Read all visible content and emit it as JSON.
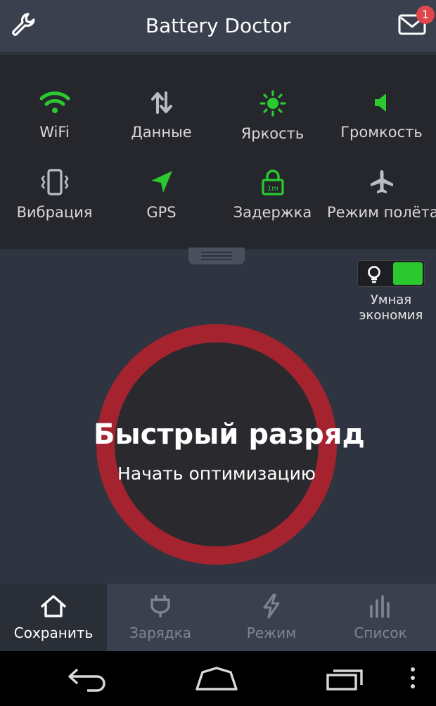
{
  "header": {
    "title": "Battery Doctor",
    "left_icon": "wrench-icon",
    "right_icon": "mail-icon",
    "notification_count": "1"
  },
  "toggles": [
    {
      "label": "WiFi",
      "icon": "wifi-icon",
      "state": "on"
    },
    {
      "label": "Данные",
      "icon": "data-transfer-icon",
      "state": "off"
    },
    {
      "label": "Яркость",
      "icon": "brightness-icon",
      "state": "on"
    },
    {
      "label": "Громкость",
      "icon": "volume-icon",
      "state": "on"
    },
    {
      "label": "Вибрация",
      "icon": "vibration-icon",
      "state": "off"
    },
    {
      "label": "GPS",
      "icon": "gps-icon",
      "state": "on"
    },
    {
      "label": "Задержка",
      "icon": "lock-timeout-icon",
      "state": "on",
      "icon_text": "1m"
    },
    {
      "label": "Режим полёта",
      "icon": "airplane-icon",
      "state": "off"
    }
  ],
  "smart_saving": {
    "label_line1": "Умная",
    "label_line2": "экономия",
    "enabled": true
  },
  "status_circle": {
    "title": "Быстрый разряд",
    "action": "Начать оптимизацию"
  },
  "tabs": [
    {
      "label": "Сохранить",
      "icon": "home-icon",
      "active": true
    },
    {
      "label": "Зарядка",
      "icon": "plug-icon",
      "active": false
    },
    {
      "label": "Режим",
      "icon": "lightning-icon",
      "active": false
    },
    {
      "label": "Список",
      "icon": "bars-icon",
      "active": false
    }
  ],
  "navbar": [
    "back-icon",
    "home-nav-icon",
    "recents-icon",
    "menu-dots-icon"
  ],
  "colors": {
    "on": "#2bc830",
    "off": "#b8bcc4",
    "ring": "#a5232e",
    "badge": "#e0474c"
  }
}
